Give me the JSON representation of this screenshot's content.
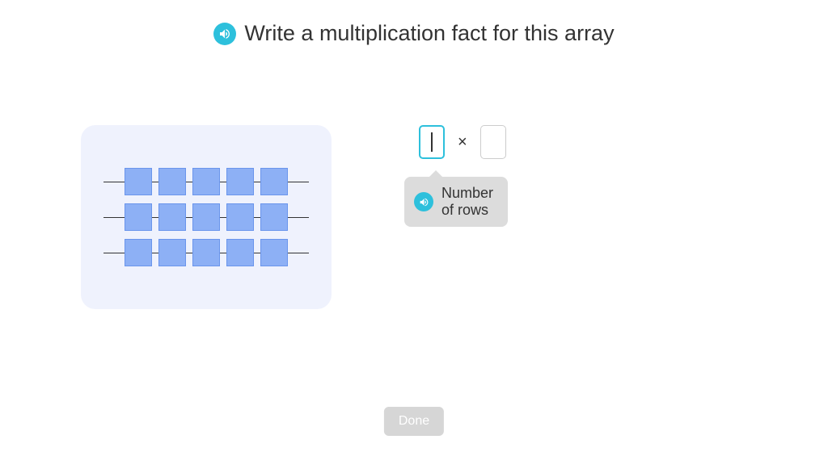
{
  "title": "Write a multiplication fact for this array",
  "array": {
    "rows": 3,
    "columns": 5
  },
  "equation": {
    "input1_value": "",
    "operator": "×",
    "input2_value": ""
  },
  "tooltip": {
    "text": "Number of rows"
  },
  "done_label": "Done"
}
